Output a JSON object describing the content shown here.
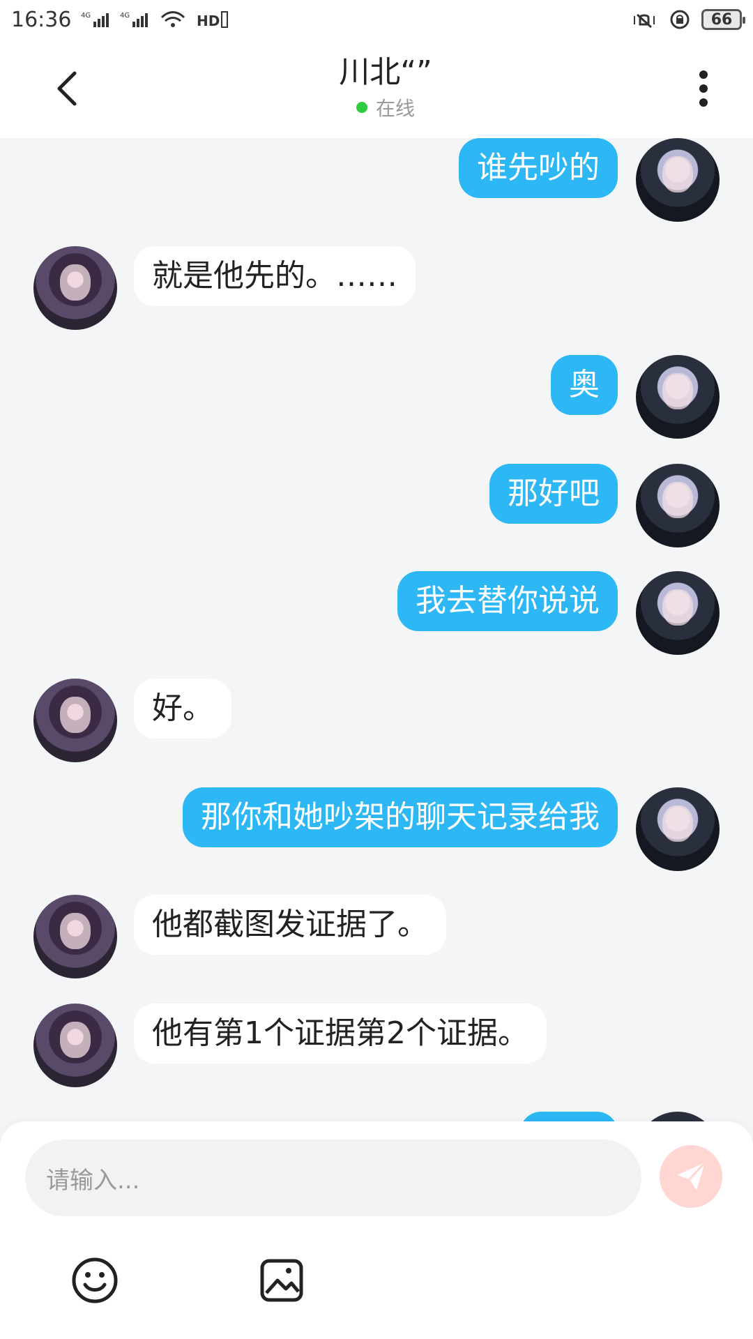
{
  "status_bar": {
    "time": "16:36",
    "battery": "66",
    "network_1": "4G",
    "network_2": "4G",
    "hd_label": "HD"
  },
  "header": {
    "title": "川北“”",
    "status": "在线"
  },
  "messages": [
    {
      "side": "right",
      "text": "谁先吵的"
    },
    {
      "side": "left",
      "text": "就是他先的。……"
    },
    {
      "side": "right",
      "text": "奥"
    },
    {
      "side": "right",
      "text": "那好吧"
    },
    {
      "side": "right",
      "text": "我去替你说说"
    },
    {
      "side": "left",
      "text": "好。"
    },
    {
      "side": "right",
      "text": "那你和她吵架的聊天记录给我"
    },
    {
      "side": "left",
      "text": "他都截图发证据了。"
    },
    {
      "side": "left",
      "text": "他有第1个证据第2个证据。"
    }
  ],
  "input": {
    "placeholder": "请输入..."
  },
  "colors": {
    "accent_blue": "#2db7f5",
    "online_green": "#2ecc40",
    "send_disabled": "#ffd6d2"
  },
  "icons": {
    "back": "chevron-left-icon",
    "more": "vertical-dots-icon",
    "emoji": "smile-icon",
    "image": "image-icon",
    "send": "send-plane-icon"
  }
}
